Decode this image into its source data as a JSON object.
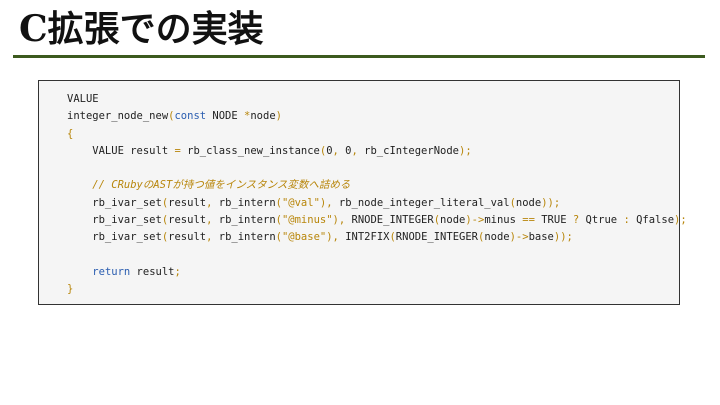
{
  "slide": {
    "title": "C拡張での実装"
  },
  "code": {
    "lines": [
      [
        {
          "t": "VALUE",
          "c": "pl"
        }
      ],
      [
        {
          "t": "integer_node_new",
          "c": "pl"
        },
        {
          "t": "(",
          "c": "pu"
        },
        {
          "t": "const",
          "c": "kw"
        },
        {
          "t": " NODE ",
          "c": "pl"
        },
        {
          "t": "*",
          "c": "pu"
        },
        {
          "t": "node",
          "c": "pl"
        },
        {
          "t": ")",
          "c": "pu"
        }
      ],
      [
        {
          "t": "{",
          "c": "pu"
        }
      ],
      [
        {
          "t": "    VALUE result ",
          "c": "pl"
        },
        {
          "t": "=",
          "c": "pu"
        },
        {
          "t": " rb_class_new_instance",
          "c": "pl"
        },
        {
          "t": "(",
          "c": "pu"
        },
        {
          "t": "0",
          "c": "pl"
        },
        {
          "t": ",",
          "c": "pu"
        },
        {
          "t": " 0",
          "c": "pl"
        },
        {
          "t": ",",
          "c": "pu"
        },
        {
          "t": " rb_cIntegerNode",
          "c": "pl"
        },
        {
          "t": ");",
          "c": "pu"
        }
      ],
      [],
      [
        {
          "t": "    // CRubyのASTが持つ値をインスタンス変数へ詰める",
          "c": "cm"
        }
      ],
      [
        {
          "t": "    rb_ivar_set",
          "c": "pl"
        },
        {
          "t": "(",
          "c": "pu"
        },
        {
          "t": "result",
          "c": "pl"
        },
        {
          "t": ",",
          "c": "pu"
        },
        {
          "t": " rb_intern",
          "c": "pl"
        },
        {
          "t": "(",
          "c": "pu"
        },
        {
          "t": "\"@val\"",
          "c": "st"
        },
        {
          "t": "),",
          "c": "pu"
        },
        {
          "t": " rb_node_integer_literal_val",
          "c": "pl"
        },
        {
          "t": "(",
          "c": "pu"
        },
        {
          "t": "node",
          "c": "pl"
        },
        {
          "t": "));",
          "c": "pu"
        }
      ],
      [
        {
          "t": "    rb_ivar_set",
          "c": "pl"
        },
        {
          "t": "(",
          "c": "pu"
        },
        {
          "t": "result",
          "c": "pl"
        },
        {
          "t": ",",
          "c": "pu"
        },
        {
          "t": " rb_intern",
          "c": "pl"
        },
        {
          "t": "(",
          "c": "pu"
        },
        {
          "t": "\"@minus\"",
          "c": "st"
        },
        {
          "t": "),",
          "c": "pu"
        },
        {
          "t": " RNODE_INTEGER",
          "c": "pl"
        },
        {
          "t": "(",
          "c": "pu"
        },
        {
          "t": "node",
          "c": "pl"
        },
        {
          "t": ")->",
          "c": "pu"
        },
        {
          "t": "minus ",
          "c": "pl"
        },
        {
          "t": "==",
          "c": "pu"
        },
        {
          "t": " TRUE ",
          "c": "pl"
        },
        {
          "t": "?",
          "c": "pu"
        },
        {
          "t": " Qtrue ",
          "c": "pl"
        },
        {
          "t": ":",
          "c": "pu"
        },
        {
          "t": " Qfalse",
          "c": "pl"
        },
        {
          "t": ");",
          "c": "pu"
        }
      ],
      [
        {
          "t": "    rb_ivar_set",
          "c": "pl"
        },
        {
          "t": "(",
          "c": "pu"
        },
        {
          "t": "result",
          "c": "pl"
        },
        {
          "t": ",",
          "c": "pu"
        },
        {
          "t": " rb_intern",
          "c": "pl"
        },
        {
          "t": "(",
          "c": "pu"
        },
        {
          "t": "\"@base\"",
          "c": "st"
        },
        {
          "t": "),",
          "c": "pu"
        },
        {
          "t": " INT2FIX",
          "c": "pl"
        },
        {
          "t": "(",
          "c": "pu"
        },
        {
          "t": "RNODE_INTEGER",
          "c": "pl"
        },
        {
          "t": "(",
          "c": "pu"
        },
        {
          "t": "node",
          "c": "pl"
        },
        {
          "t": ")->",
          "c": "pu"
        },
        {
          "t": "base",
          "c": "pl"
        },
        {
          "t": "));",
          "c": "pu"
        }
      ],
      [],
      [
        {
          "t": "    ",
          "c": "pl"
        },
        {
          "t": "return",
          "c": "kw"
        },
        {
          "t": " result",
          "c": "pl"
        },
        {
          "t": ";",
          "c": "pu"
        }
      ],
      [
        {
          "t": "}",
          "c": "pu"
        }
      ]
    ]
  }
}
